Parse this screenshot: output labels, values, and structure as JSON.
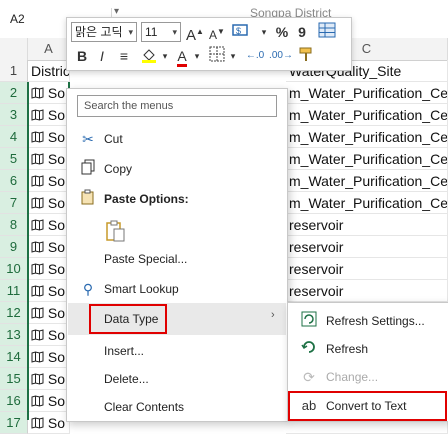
{
  "formula_bar": {
    "name_box": "A2",
    "formula": "Songpa District"
  },
  "mini_toolbar": {
    "font_name": "맑은 고딕",
    "font_size": "11",
    "bold": "B",
    "italic": "I",
    "font_color_label": "A",
    "percent": "%",
    "comma": "9"
  },
  "columns": [
    {
      "id": "col-header-a",
      "label": "A"
    },
    {
      "id": "col-header-c",
      "label": "C"
    }
  ],
  "rows": [
    {
      "num": "1",
      "a": "District",
      "c": "WaterQuality_Site"
    },
    {
      "num": "2",
      "a": "So",
      "c": "m_Water_Purification_Ce"
    },
    {
      "num": "3",
      "a": "So",
      "c": "m_Water_Purification_Ce"
    },
    {
      "num": "4",
      "a": "So",
      "c": "m_Water_Purification_Ce"
    },
    {
      "num": "5",
      "a": "So",
      "c": "m_Water_Purification_Ce"
    },
    {
      "num": "6",
      "a": "So",
      "c": "m_Water_Purification_Ce"
    },
    {
      "num": "7",
      "a": "So",
      "c": "m_Water_Purification_Ce"
    },
    {
      "num": "8",
      "a": "So",
      "c": "reservoir"
    },
    {
      "num": "9",
      "a": "So",
      "c": "reservoir"
    },
    {
      "num": "10",
      "a": "So",
      "c": "reservoir"
    },
    {
      "num": "11",
      "a": "So",
      "c": "reservoir"
    },
    {
      "num": "12",
      "a": "So",
      "c": ""
    },
    {
      "num": "13",
      "a": "So",
      "c": ""
    },
    {
      "num": "14",
      "a": "So",
      "c": ""
    },
    {
      "num": "15",
      "a": "So",
      "c": ""
    },
    {
      "num": "16",
      "a": "So",
      "c": ""
    },
    {
      "num": "17",
      "a": "So",
      "c": ""
    }
  ],
  "context_menu": {
    "search_placeholder": "Search the menus",
    "cut": "Cut",
    "copy": "Copy",
    "paste_options": "Paste Options:",
    "paste_special": "Paste Special...",
    "smart_lookup": "Smart Lookup",
    "data_type": "Data Type",
    "insert": "Insert...",
    "delete": "Delete...",
    "clear_contents": "Clear Contents"
  },
  "submenu": {
    "refresh_settings": "Refresh Settings...",
    "refresh": "Refresh",
    "change": "Change...",
    "convert_to_text": "Convert to Text",
    "convert_icon_text": "ab"
  },
  "colors": {
    "accent_green": "#1e7145",
    "highlight_red": "#e00000",
    "menu_hover": "#e9e9e9"
  }
}
